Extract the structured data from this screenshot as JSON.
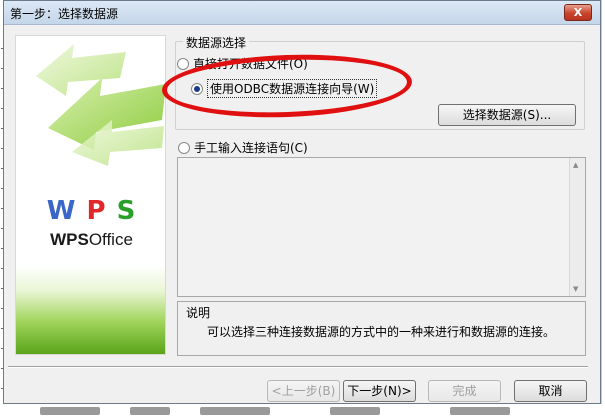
{
  "dialog": {
    "title": "第一步：选择数据源",
    "close_glyph": "X"
  },
  "banner": {
    "logo_letters": [
      "W",
      "P",
      "S"
    ],
    "logo_wps": "WPS",
    "logo_office": "Office"
  },
  "datasource_group": {
    "title": "数据源选择",
    "option_file": "直接打开数据文件(O)",
    "option_odbc": "使用ODBC数据源连接向导(W)",
    "selected": "odbc",
    "select_button": "选择数据源(S)..."
  },
  "manual": {
    "label": "手工输入连接语句(C)",
    "value": ""
  },
  "description": {
    "title": "说明",
    "text": "可以选择三种连接数据源的方式中的一种来进行和数据源的连接。"
  },
  "footer": {
    "prev": "<上一步(B)",
    "next": "下一步(N)>",
    "finish": "完成",
    "cancel": "取消"
  },
  "colors": {
    "annotation": "#e01010",
    "wps_w": "#3a66c8",
    "wps_p": "#e0282a",
    "wps_s": "#2aa02a"
  },
  "icons": [
    "close-icon",
    "arrow-graphic",
    "scroll-up-icon",
    "scroll-down-icon"
  ]
}
